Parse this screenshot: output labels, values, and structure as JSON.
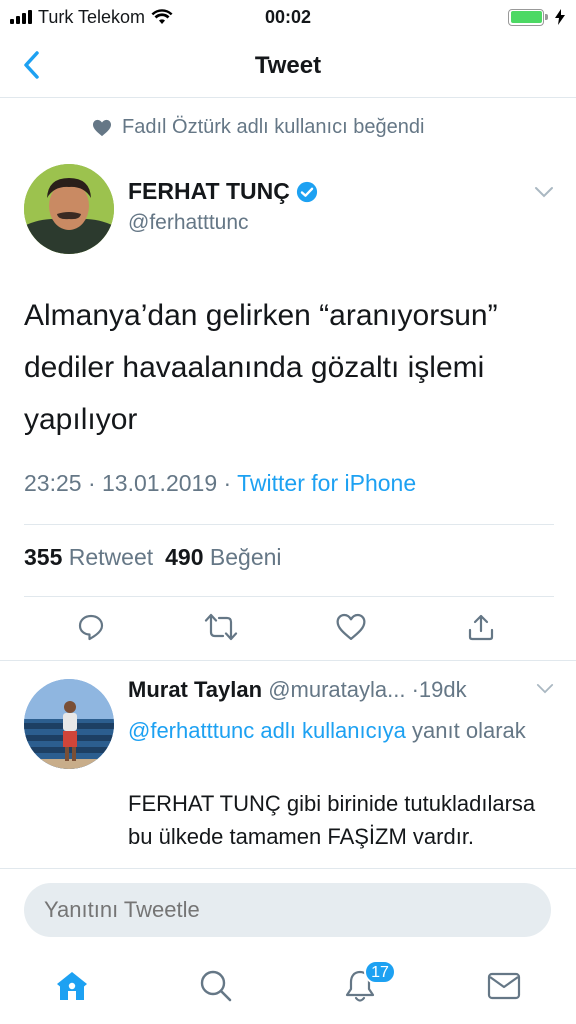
{
  "status_bar": {
    "carrier": "Turk Telekom",
    "time": "00:02"
  },
  "nav": {
    "title": "Tweet"
  },
  "social_context": {
    "text": "Fadıl Öztürk adlı kullanıcı beğendi"
  },
  "tweet": {
    "author_name": "FERHAT TUNÇ",
    "author_handle": "@ferhatttunc",
    "text": "Almanya’dan gelirken “aranıyorsun” dediler havaalanında gözaltı işlemi yapılıyor",
    "timestamp": "23:25 · 13.01.2019 · ",
    "source": "Twitter for iPhone",
    "retweet_count": "355",
    "retweet_label": "Retweet",
    "like_count": "490",
    "like_label": "Beğeni"
  },
  "reply": {
    "author_name": "Murat Taylan",
    "author_handle": "@muratayla...",
    "time": "·19dk",
    "mention": "@ferhatttunc adlı kullanıcıya",
    "reply_suffix": " yanıt olarak",
    "text": "FERHAT TUNÇ gibi birinide tutukladılarsa bu ülkede tamamen FAŞİZM vardır."
  },
  "composer": {
    "placeholder": "Yanıtını Tweetle"
  },
  "tabs": {
    "notifications_badge": "17"
  },
  "colors": {
    "accent": "#1da1f2",
    "secondary_text": "#657786",
    "divider": "#e1e8ed"
  }
}
